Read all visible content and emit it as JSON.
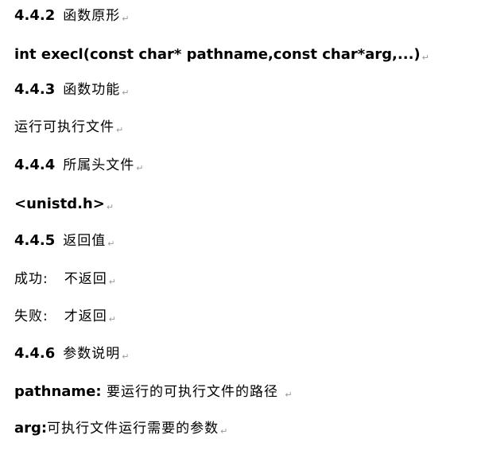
{
  "doc": {
    "paragraph_mark": "↵",
    "sections": [
      {
        "number": "4.4.2",
        "title": "函数原形",
        "content": "int execl(const char* pathname,const char*arg,...)"
      },
      {
        "number": "4.4.3",
        "title": "函数功能",
        "content": "运行可执行文件"
      },
      {
        "number": "4.4.4",
        "title": "所属头文件",
        "content": "<unistd.h>"
      },
      {
        "number": "4.4.5",
        "title": "返回值"
      },
      {
        "number": "4.4.6",
        "title": "参数说明"
      }
    ],
    "return_values": [
      {
        "label": "成功:",
        "text": "不返回"
      },
      {
        "label": "失败:",
        "text": "才返回"
      }
    ],
    "params": [
      {
        "name": "pathname:",
        "desc": " 要运行的可执行文件的路径 "
      },
      {
        "name": "arg:",
        "desc": "可执行文件运行需要的参数"
      }
    ]
  }
}
